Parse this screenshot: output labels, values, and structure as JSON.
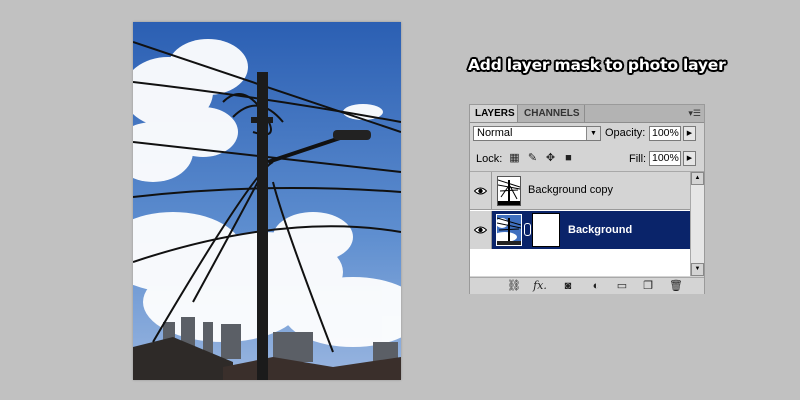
{
  "heading": "Add layer mask to photo layer",
  "panel": {
    "tabs": [
      "LAYERS",
      "CHANNELS"
    ],
    "blend_mode": "Normal",
    "opacity_label": "Opacity:",
    "opacity_value": "100%",
    "lock_label": "Lock:",
    "fill_label": "Fill:",
    "fill_value": "100%",
    "layers": [
      {
        "name": "Background copy",
        "selected": false,
        "visible": true
      },
      {
        "name": "Background",
        "selected": true,
        "visible": true,
        "has_mask": true
      }
    ],
    "selection_color": "#0a246a"
  },
  "icons": {
    "panel_menu": "panel-menu-icon",
    "lock": [
      "lock-transparent-icon",
      "lock-brush-icon",
      "lock-move-icon",
      "lock-all-icon"
    ],
    "footer": [
      "link-layers-icon",
      "fx-icon",
      "add-mask-icon",
      "adjustment-layer-icon",
      "new-group-icon",
      "new-layer-icon",
      "trash-icon"
    ]
  }
}
